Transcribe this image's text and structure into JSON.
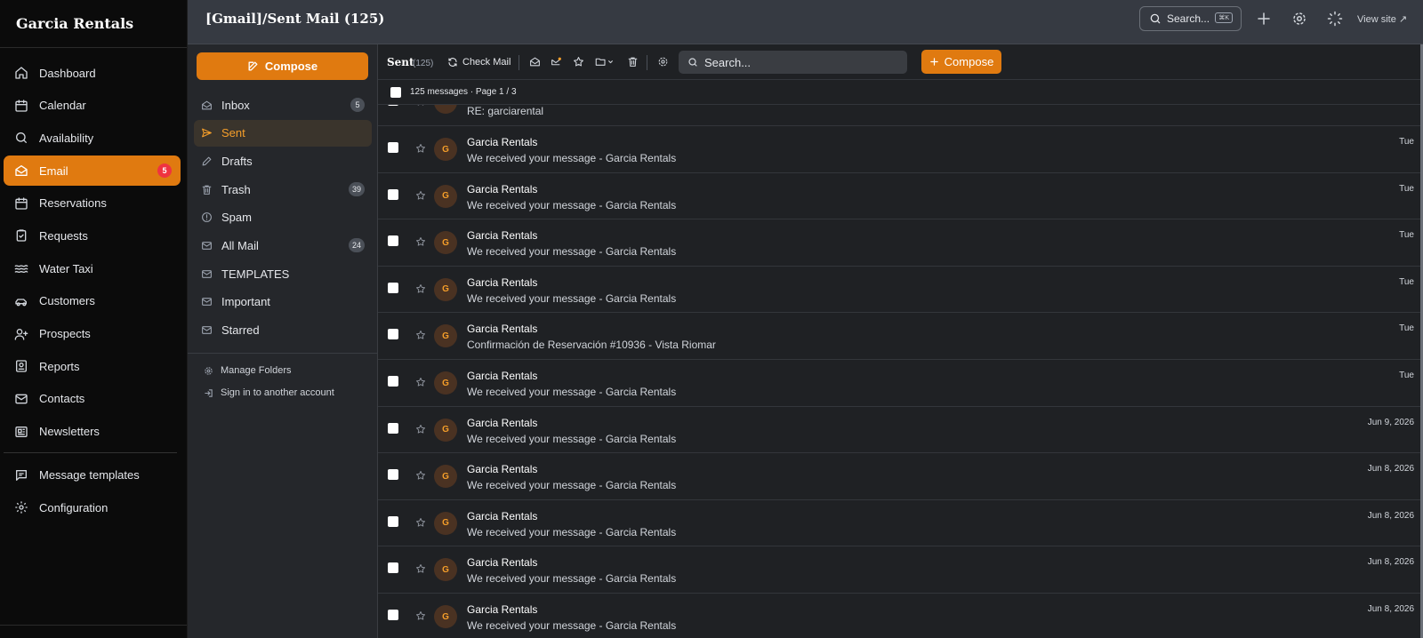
{
  "app": {
    "brand": "Garcia Rentals"
  },
  "sidebar": {
    "items": [
      {
        "label": "Dashboard",
        "icon": "home-icon"
      },
      {
        "label": "Calendar",
        "icon": "calendar-icon"
      },
      {
        "label": "Availability",
        "icon": "search-icon"
      },
      {
        "label": "Email",
        "icon": "mail-open-icon",
        "badge": "5",
        "active": true
      },
      {
        "label": "Reservations",
        "icon": "calendar-icon"
      },
      {
        "label": "Requests",
        "icon": "clipboard-icon"
      },
      {
        "label": "Water Taxi",
        "icon": "waves-icon"
      },
      {
        "label": "Customers",
        "icon": "car-icon"
      },
      {
        "label": "Prospects",
        "icon": "user-plus-icon"
      },
      {
        "label": "Reports",
        "icon": "report-icon"
      },
      {
        "label": "Contacts",
        "icon": "mail-icon"
      },
      {
        "label": "Newsletters",
        "icon": "newspaper-icon"
      }
    ],
    "secondary": [
      {
        "label": "Message templates",
        "icon": "message-icon"
      },
      {
        "label": "Configuration",
        "icon": "gear-icon"
      }
    ]
  },
  "topbar": {
    "title": "[Gmail]/Sent Mail (125)",
    "search_label": "Search...",
    "search_kbd": "⌘K",
    "view_site": "View site ↗"
  },
  "folders": {
    "compose_label": "Compose",
    "items": [
      {
        "label": "Inbox",
        "icon": "inbox-icon",
        "count": "5"
      },
      {
        "label": "Sent",
        "icon": "send-icon",
        "count": "",
        "active": true
      },
      {
        "label": "Drafts",
        "icon": "pencil-icon",
        "count": ""
      },
      {
        "label": "Trash",
        "icon": "trash-icon",
        "count": "39"
      },
      {
        "label": "Spam",
        "icon": "alert-icon",
        "count": ""
      },
      {
        "label": "All Mail",
        "icon": "mail-icon",
        "count": "24"
      },
      {
        "label": "TEMPLATES",
        "icon": "mail-icon",
        "count": ""
      },
      {
        "label": "Important",
        "icon": "mail-icon",
        "count": ""
      },
      {
        "label": "Starred",
        "icon": "mail-icon",
        "count": ""
      }
    ],
    "manage_folders": "Manage Folders",
    "sign_in_other": "Sign in to another account"
  },
  "toolbar": {
    "folder_title": "Sent",
    "folder_count": "(125)",
    "check_mail": "Check Mail",
    "search_placeholder": "Search...",
    "compose_label": "Compose"
  },
  "list": {
    "summary": "125 messages · Page 1 / 3",
    "rows": [
      {
        "avatar": "A",
        "sender": "",
        "subject": "RE: garciarental",
        "date": ""
      },
      {
        "avatar": "G",
        "sender": "Garcia Rentals",
        "subject": "We received your message - Garcia Rentals",
        "date": "Tue"
      },
      {
        "avatar": "G",
        "sender": "Garcia Rentals",
        "subject": "We received your message - Garcia Rentals",
        "date": "Tue"
      },
      {
        "avatar": "G",
        "sender": "Garcia Rentals",
        "subject": "We received your message - Garcia Rentals",
        "date": "Tue"
      },
      {
        "avatar": "G",
        "sender": "Garcia Rentals",
        "subject": "We received your message - Garcia Rentals",
        "date": "Tue"
      },
      {
        "avatar": "G",
        "sender": "Garcia Rentals",
        "subject": "Confirmación de Reservación #10936 - Vista Riomar",
        "date": "Tue"
      },
      {
        "avatar": "G",
        "sender": "Garcia Rentals",
        "subject": "We received your message - Garcia Rentals",
        "date": "Tue"
      },
      {
        "avatar": "G",
        "sender": "Garcia Rentals",
        "subject": "We received your message - Garcia Rentals",
        "date": "Jun 9, 2026"
      },
      {
        "avatar": "G",
        "sender": "Garcia Rentals",
        "subject": "We received your message - Garcia Rentals",
        "date": "Jun 8, 2026"
      },
      {
        "avatar": "G",
        "sender": "Garcia Rentals",
        "subject": "We received your message - Garcia Rentals",
        "date": "Jun 8, 2026"
      },
      {
        "avatar": "G",
        "sender": "Garcia Rentals",
        "subject": "We received your message - Garcia Rentals",
        "date": "Jun 8, 2026"
      },
      {
        "avatar": "G",
        "sender": "Garcia Rentals",
        "subject": "We received your message - Garcia Rentals",
        "date": "Jun 8, 2026"
      }
    ]
  },
  "colors": {
    "accent": "#e07a10",
    "badge": "#ef3340",
    "active_folder_text": "#f59e2a"
  }
}
